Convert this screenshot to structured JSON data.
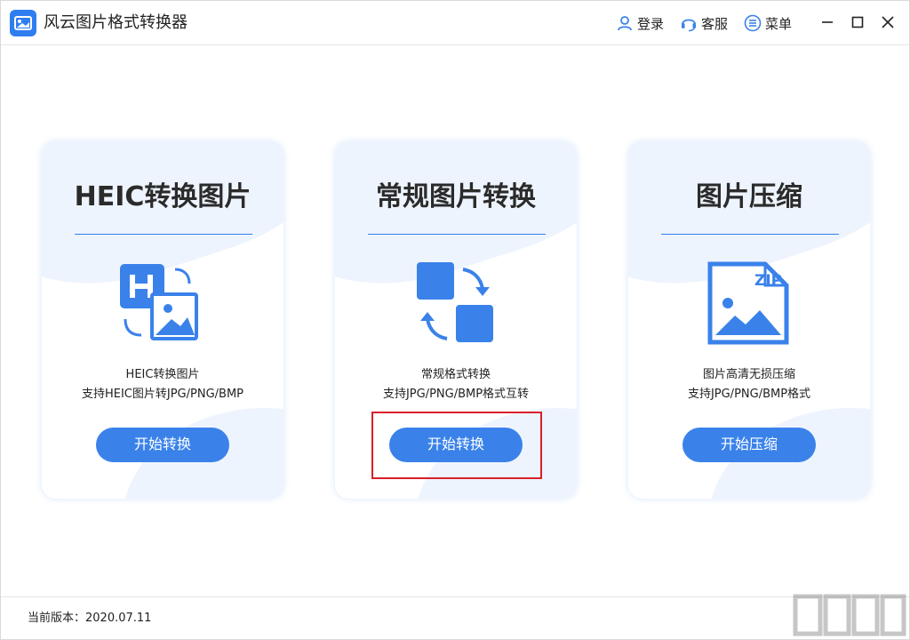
{
  "app": {
    "title": "风云图片格式转换器",
    "logo_icon": "image-convert-icon"
  },
  "header": {
    "login_label": "登录",
    "support_label": "客服",
    "menu_label": "菜单"
  },
  "cards": [
    {
      "title": "HEIC转换图片",
      "icon": "heic-image-icon",
      "desc1": "HEIC转换图片",
      "desc2": "支持HEIC图片转JPG/PNG/BMP",
      "button": "开始转换"
    },
    {
      "title": "常规图片转换",
      "icon": "convert-arrows-icon",
      "desc1": "常规格式转换",
      "desc2": "支持JPG/PNG/BMP格式互转",
      "button": "开始转换"
    },
    {
      "title": "图片压缩",
      "icon": "zip-image-icon",
      "desc1": "图片高清无损压缩",
      "desc2": "支持JPG/PNG/BMP格式",
      "button": "开始压缩"
    }
  ],
  "footer": {
    "version": "当前版本：2020.07.11"
  },
  "colors": {
    "accent": "#3a82ea",
    "highlight": "#d9202a"
  }
}
